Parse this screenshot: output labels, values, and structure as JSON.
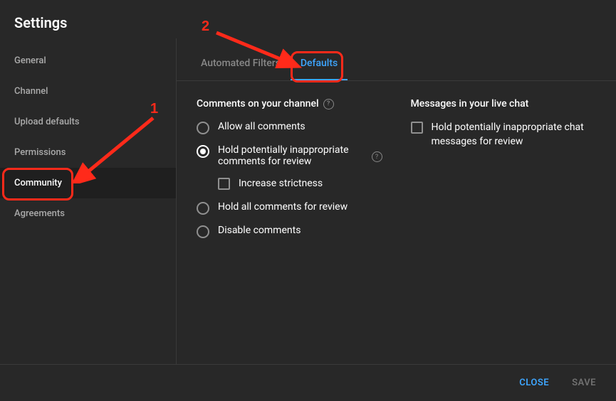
{
  "header": {
    "title": "Settings"
  },
  "sidebar": {
    "items": [
      {
        "label": "General"
      },
      {
        "label": "Channel"
      },
      {
        "label": "Upload defaults"
      },
      {
        "label": "Permissions"
      },
      {
        "label": "Community"
      },
      {
        "label": "Agreements"
      }
    ],
    "active_index": 4
  },
  "tabs": {
    "items": [
      {
        "label": "Automated Filters"
      },
      {
        "label": "Defaults"
      }
    ],
    "active_index": 1
  },
  "comments_section": {
    "title": "Comments on your channel",
    "options": [
      "Allow all comments",
      "Hold potentially inappropriate comments for review",
      "Hold all comments for review",
      "Disable comments"
    ],
    "selected_index": 1,
    "sub_option": "Increase strictness"
  },
  "livechat_section": {
    "title": "Messages in your live chat",
    "option": "Hold potentially inappropriate chat messages for review"
  },
  "footer": {
    "close": "CLOSE",
    "save": "SAVE"
  },
  "annotations": {
    "num1": "1",
    "num2": "2"
  }
}
